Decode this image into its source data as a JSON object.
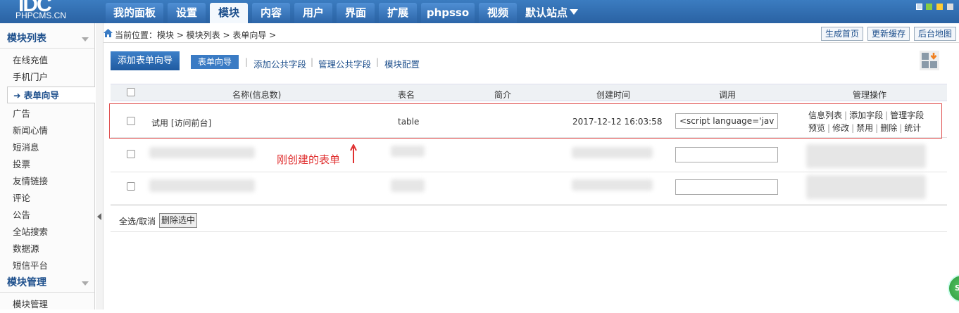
{
  "header": {
    "logo_big": "IDC",
    "logo_small": "PHPCMS.CN",
    "nav": [
      {
        "label": "我的面板"
      },
      {
        "label": "设置"
      },
      {
        "label": "模块"
      },
      {
        "label": "内容"
      },
      {
        "label": "用户"
      },
      {
        "label": "界面"
      },
      {
        "label": "扩展"
      },
      {
        "label": "phpsso"
      },
      {
        "label": "视频"
      }
    ],
    "active_nav": "模块",
    "site_switch": "默认站点"
  },
  "sidebar": {
    "section1_title": "模块列表",
    "items": [
      {
        "label": "在线充值"
      },
      {
        "label": "手机门户"
      },
      {
        "label": "表单向导"
      },
      {
        "label": "广告"
      },
      {
        "label": "新闻心情"
      },
      {
        "label": "短消息"
      },
      {
        "label": "投票"
      },
      {
        "label": "友情链接"
      },
      {
        "label": "评论"
      },
      {
        "label": "公告"
      },
      {
        "label": "全站搜索"
      },
      {
        "label": "数据源"
      },
      {
        "label": "短信平台"
      }
    ],
    "active_item": "表单向导",
    "section2_title": "模块管理",
    "section2_items": [
      {
        "label": "模块管理"
      }
    ]
  },
  "breadcrumb": {
    "text": "当前位置：模块 > 模块列表 > 表单向导 >"
  },
  "top_buttons": {
    "generate_home": "生成首页",
    "update_cache": "更新缓存",
    "backend_map": "后台地图"
  },
  "toolbar": {
    "add_form_wizard": "添加表单向导",
    "form_wizard_tab": "表单向导",
    "links": [
      "添加公共字段",
      "管理公共字段",
      "模块配置"
    ]
  },
  "table": {
    "columns": [
      "名称(信息数)",
      "表名",
      "简介",
      "创建时间",
      "调用",
      "管理操作"
    ],
    "rows": [
      {
        "name": "试用 [访问前台]",
        "table_name": "table",
        "intro": "",
        "created": "2017-12-12 16:03:58",
        "call_code": "<script language='jav",
        "ops_line1": [
          "信息列表",
          "添加字段",
          "管理字段"
        ],
        "ops_line2": [
          "预览",
          "修改",
          "禁用",
          "删除",
          "统计"
        ]
      }
    ]
  },
  "annotation": {
    "text": "刚创建的表单"
  },
  "footer": {
    "select_all": "全选/取消",
    "delete_selected": "删除选中"
  },
  "colors": {
    "accent": "#2a62a3",
    "annotation": "#e03030"
  }
}
